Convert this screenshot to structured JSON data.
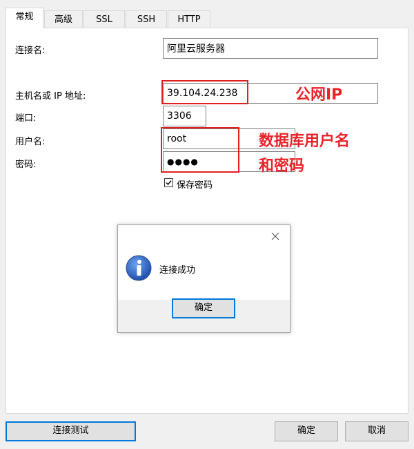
{
  "tabs": [
    {
      "label": "常规",
      "active": true
    },
    {
      "label": "高级",
      "active": false
    },
    {
      "label": "SSL",
      "active": false
    },
    {
      "label": "SSH",
      "active": false
    },
    {
      "label": "HTTP",
      "active": false
    }
  ],
  "form": {
    "connection_name_label": "连接名:",
    "connection_name_value": "阿里云服务器",
    "host_label": "主机名或 IP 地址:",
    "host_value": "39.104.24.238",
    "port_label": "端口:",
    "port_value": "3306",
    "username_label": "用户名:",
    "username_value": "root",
    "password_label": "密码:",
    "password_value": "●●●●",
    "save_password_label": "保存密码",
    "save_password_checked": true
  },
  "annotations": {
    "public_ip": "公网IP",
    "db_user_line1": "数据库用户名",
    "db_user_line2": "和密码",
    "color": "#e8242a"
  },
  "dialog": {
    "icon": "info-icon",
    "message": "连接成功",
    "ok_label": "确定",
    "close_icon": "close-icon"
  },
  "footer": {
    "test_label": "连接测试",
    "ok_label": "确定",
    "cancel_label": "取消"
  },
  "colors": {
    "accent": "#0078d7",
    "annotation_red": "#e8242a",
    "info_blue": "#1f5fbf"
  }
}
